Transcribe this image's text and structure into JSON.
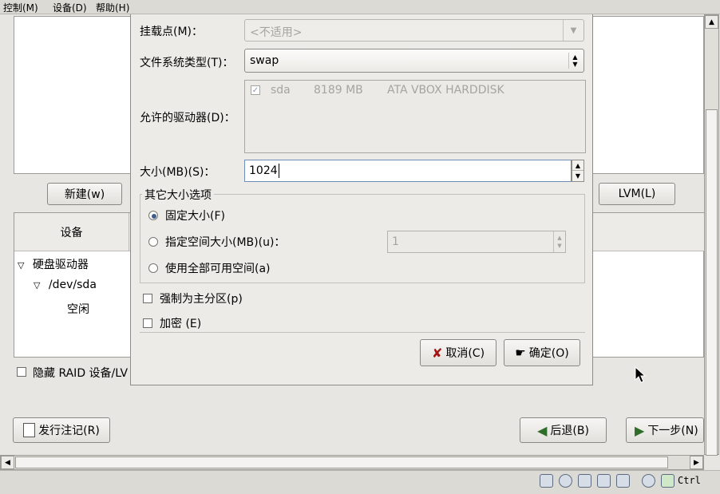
{
  "menubar": {
    "items": [
      "控制(M)",
      "设备(D)",
      "帮助(H)"
    ]
  },
  "background": {
    "new_button": "新建(w)",
    "lvm_button": "LVM(L)",
    "device_column": "设备",
    "tree": [
      "硬盘驱动器",
      "/dev/sda",
      "空闲"
    ],
    "hide_raid_label": "隐藏 RAID 设备/LV",
    "release_notes_button": "发行注记(R)",
    "back_button": "后退(B)",
    "next_button": "下一步(N)"
  },
  "dialog": {
    "mount_point": {
      "label": "挂载点(M)：",
      "value": "<不适用>"
    },
    "fs_type": {
      "label": "文件系统类型(T)：",
      "value": "swap"
    },
    "drives": {
      "label": "允许的驱动器(D)：",
      "rows": [
        {
          "checked": true,
          "name": "sda",
          "size": "8189 MB",
          "model": "ATA VBOX HARDDISK"
        }
      ]
    },
    "size": {
      "label": "大小(MB)(S)：",
      "value": "1024"
    },
    "other_size": {
      "title": "其它大小选项",
      "fixed": "固定大小(F)",
      "upto": "指定空间大小(MB)(u)：",
      "upto_value": "1",
      "fill": "使用全部可用空间(a)",
      "selected": "fixed"
    },
    "force_primary": "强制为主分区(p)",
    "encrypt": "加密 (E)",
    "cancel": "取消(C)",
    "ok": "确定(O)"
  },
  "statusbar": {
    "host_key": "Ctrl"
  }
}
